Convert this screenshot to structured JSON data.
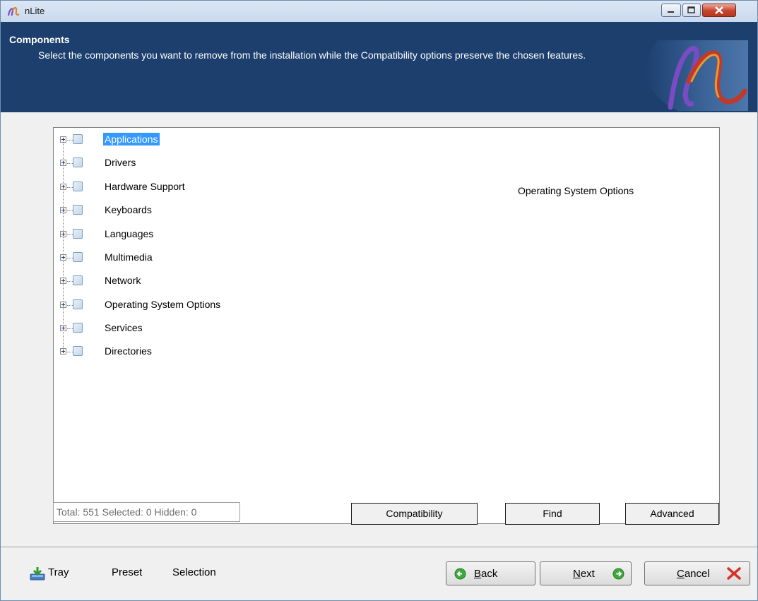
{
  "window": {
    "title": "nLite",
    "icon": "nlite-logo-icon"
  },
  "header": {
    "title": "Components",
    "description": "Select the components you want to remove from the installation while the Compatibility options preserve the chosen features."
  },
  "tree": {
    "items": [
      {
        "label": "Applications",
        "selected": true
      },
      {
        "label": "Drivers"
      },
      {
        "label": "Hardware Support"
      },
      {
        "label": "Keyboards"
      },
      {
        "label": "Languages"
      },
      {
        "label": "Multimedia"
      },
      {
        "label": "Network"
      },
      {
        "label": "Operating System Options"
      },
      {
        "label": "Services"
      },
      {
        "label": "Directories"
      }
    ],
    "side_note": "Operating System Options"
  },
  "status": "Total: 551 Selected: 0 Hidden: 0",
  "buttons": {
    "compatibility": "Compatibility",
    "find": "Find",
    "advanced": "Advanced"
  },
  "footer": {
    "tray": "Tray",
    "preset": "Preset",
    "selection": "Selection",
    "back_pre": "",
    "back_u": "B",
    "back_post": "ack",
    "next_pre": "",
    "next_u": "N",
    "next_post": "ext",
    "cancel_pre": "",
    "cancel_u": "C",
    "cancel_post": "ancel"
  },
  "colors": {
    "header_bg": "#1c3f6e",
    "selection": "#3399ff",
    "green_icon": "#3fa93b",
    "cancel_x": "#d6322a"
  }
}
